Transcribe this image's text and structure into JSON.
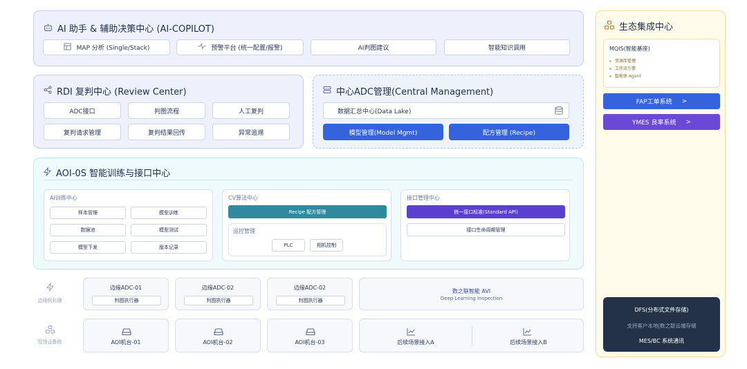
{
  "copilot": {
    "title": "AI 助手 & 辅助决策中心 (AI-COPILOT)",
    "buttons": [
      "MAP 分析 (Single/Stack)",
      "预警平台 (统一配置/报警)",
      "AI判图建议",
      "智能知识调用"
    ]
  },
  "rdi": {
    "title": "RDI 复判中心 (Review Center)",
    "buttons": [
      "ADC接口",
      "判图流程",
      "人工复判",
      "复判请求管理",
      "复判结果回传",
      "异常追溯"
    ]
  },
  "central": {
    "title": "中心ADC管理(Central Management)",
    "datalake": "数据汇总中心(Data Lake)",
    "buttons": [
      "模型管理(Model Mgmt)",
      "配方管理 (Recipe)"
    ]
  },
  "eco": {
    "title": "生态集成中心",
    "mqis_title": "MQIS(智能基座)",
    "mqis_items": [
      "资源库管理",
      "工作流引擎",
      "智能体 Agent"
    ],
    "fap": "FAP工单系统",
    "ymes": "YMES 良率系统",
    "arrow": ">",
    "dfs_title": "DFS(分布式文件存储)",
    "dfs_sub": "支持客户本地|数之联云端存储",
    "dfs_mes": "MES/BC 系统通讯"
  },
  "aoi": {
    "title": "AOI-0S 智能训练与接口中心",
    "train_title": "AI训练中心",
    "train_buttons": [
      "样本管理",
      "模型训练",
      "数据池",
      "模型测试",
      "模型下发",
      "版本记录"
    ],
    "cv_title": "CV算法中心",
    "cv_recipe": "Recipe 配方管理",
    "ctrl_title": "运控管理",
    "ctrl_buttons": [
      "PLC",
      "相机控制"
    ],
    "api_title": "接口管理中心",
    "api_std": "统一接口标准(Standard API)",
    "api_life": "接口生命周期管理"
  },
  "edge": {
    "label": "边缘侧处理",
    "cards": [
      {
        "title": "边缘ADC-01",
        "sub": "判图执行器"
      },
      {
        "title": "边缘ADC-02",
        "sub": "判图执行器"
      },
      {
        "title": "边缘ADC-02",
        "sub": "判图执行器"
      }
    ],
    "avi_title": "数之联智能 AVI",
    "avi_sub": "Deep Learning Inspection"
  },
  "field": {
    "label": "现场设备侧",
    "machines": [
      "AOI机台-01",
      "AOI机台-02",
      "AOI机台-03"
    ],
    "scenes": [
      "后续场景接入A",
      "后续场景接入B"
    ]
  },
  "colors": {
    "copilot_bg": "#eef1fb",
    "copilot_border": "#c6cdee",
    "aoi_bg": "#eefafb",
    "aoi_border": "#bfe9ef",
    "eco_bg": "#fefbea",
    "eco_border": "#f3df9a",
    "blue": "#3563de",
    "purple": "#6c48d6",
    "teal": "#2f8aa0",
    "dark": "#243247"
  }
}
